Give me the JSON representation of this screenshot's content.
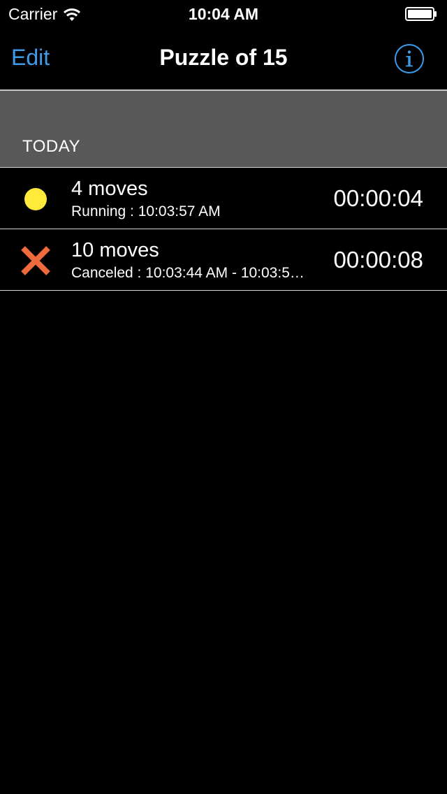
{
  "status_bar": {
    "carrier": "Carrier",
    "time": "10:04 AM"
  },
  "nav": {
    "edit_label": "Edit",
    "title": "Puzzle of 15",
    "info_icon": "info-icon"
  },
  "section": {
    "title": "TODAY"
  },
  "rows": [
    {
      "title": "4 moves",
      "subtitle": "Running : 10:03:57 AM",
      "time": "00:00:04",
      "status_icon": "running-dot-icon",
      "status_color": "#ffe93a"
    },
    {
      "title": "10 moves",
      "subtitle": "Canceled : 10:03:44 AM - 10:03:5…",
      "time": "00:00:08",
      "status_icon": "canceled-x-icon",
      "status_color": "#ef6a3c"
    }
  ],
  "colors": {
    "accent": "#3d9be9",
    "background": "#000000",
    "section_bg": "#585858"
  }
}
